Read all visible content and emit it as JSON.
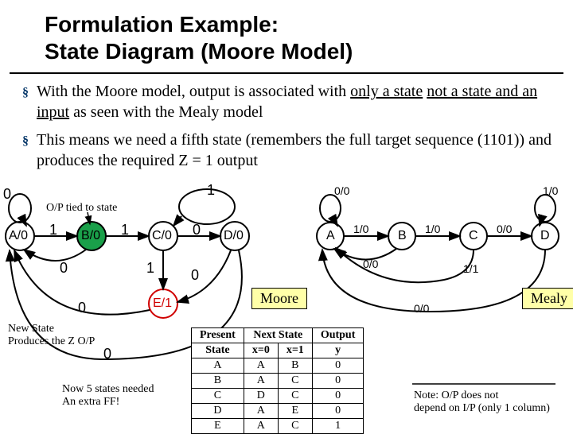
{
  "title_line1": "Formulation Example:",
  "title_line2": "State Diagram (Moore Model)",
  "bullet1_pre": "With the Moore model, output is associated with ",
  "bullet1_u1": "only a state",
  "bullet1_mid": " ",
  "bullet1_u2": "not a state and an input",
  "bullet1_post": " as seen with the Mealy model",
  "bullet2": "This means we need a fifth state (remembers the full target sequence (1101)) and produces the required Z = 1 output",
  "moore": {
    "op_tied": "O/P tied to state",
    "A": "A/0",
    "B": "B/0",
    "C": "C/0",
    "D": "D/0",
    "E": "E/1",
    "loopA": "0",
    "AB": "1",
    "BC": "1",
    "CD": "0",
    "self_loop_right": "1",
    "BA_back": "0",
    "CE_down": "1",
    "DE": "0",
    "EA": "0",
    "bottom0": "0",
    "new_state_note": "New State\nProduces the Z O/P",
    "five_states_note": "Now 5 states needed\nAn extra FF!"
  },
  "mealy": {
    "A": "A",
    "B": "B",
    "C": "C",
    "D": "D",
    "loopA": "0/0",
    "loopD": "1/0",
    "AB": "1/0",
    "BC": "1/0",
    "CD": "0/0",
    "BA": "0/0",
    "CE": "1/1",
    "DA": "0/0"
  },
  "labels": {
    "moore": "Moore",
    "mealy": "Mealy"
  },
  "table": {
    "h_present": "Present",
    "h_next": "Next State",
    "h_out": "Output",
    "h_state": "State",
    "h_x0": "x=0",
    "h_x1": "x=1",
    "h_y": "y",
    "rows": [
      {
        "p": "A",
        "n0": "A",
        "n1": "B",
        "y": "0"
      },
      {
        "p": "B",
        "n0": "A",
        "n1": "C",
        "y": "0"
      },
      {
        "p": "C",
        "n0": "D",
        "n1": "C",
        "y": "0"
      },
      {
        "p": "D",
        "n0": "A",
        "n1": "E",
        "y": "0"
      },
      {
        "p": "E",
        "n0": "A",
        "n1": "C",
        "y": "1"
      }
    ]
  },
  "output_note": "Note: O/P does not\ndepend on I/P (only 1 column)"
}
